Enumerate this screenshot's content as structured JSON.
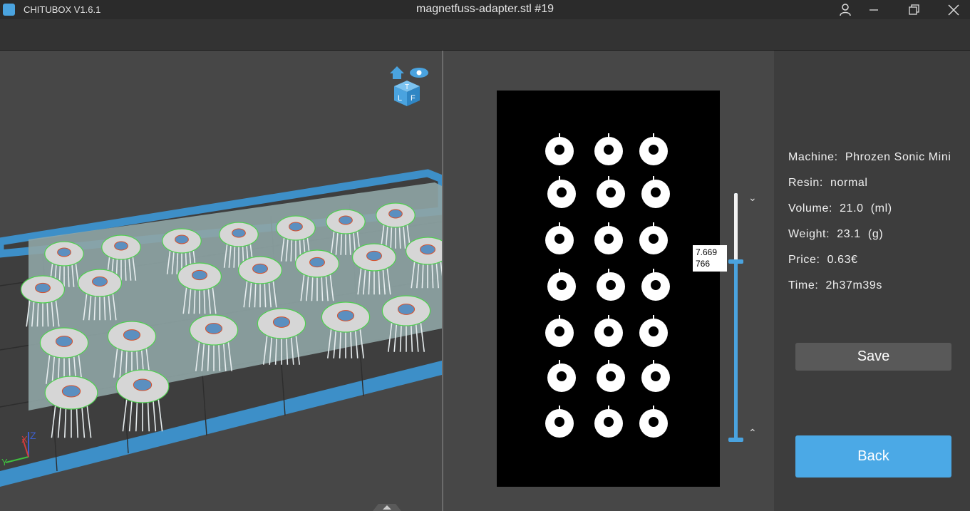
{
  "app": {
    "name": "CHITUBOX V1.6.1"
  },
  "window": {
    "title": "magnetfuss-adapter.stl #19"
  },
  "viewport": {
    "nav_cube_labels": [
      "T",
      "L",
      "F"
    ],
    "axis_labels": {
      "x": "X",
      "y": "Y",
      "z": "Z"
    }
  },
  "slice": {
    "layer_height": "7.669",
    "layer_index": "766",
    "down_glyph": "⌄",
    "up_glyph": "⌃"
  },
  "info": {
    "machine_label": "Machine:",
    "machine_value": "Phrozen Sonic Mini",
    "resin_label": "Resin:",
    "resin_value": "normal",
    "volume_label": "Volume:",
    "volume_value": "21.0",
    "volume_unit": "(ml)",
    "weight_label": "Weight:",
    "weight_value": "23.1",
    "weight_unit": "(g)",
    "price_label": "Price:",
    "price_value": "0.63€",
    "time_label": "Time:",
    "time_value": "2h37m39s"
  },
  "buttons": {
    "save": "Save",
    "back": "Back"
  },
  "colors": {
    "accent": "#4ba9e6",
    "plate": "#3d8fc8",
    "model": "#d6d6d6"
  }
}
